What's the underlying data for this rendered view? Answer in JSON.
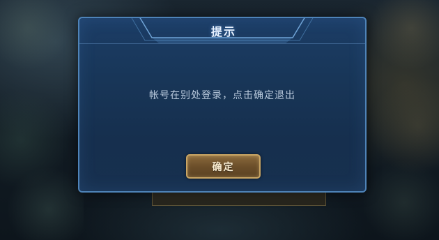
{
  "dialog": {
    "title": "提示",
    "message": "帐号在别处登录，点击确定退出",
    "confirm_label": "确定"
  },
  "colors": {
    "dialog_border": "#4e83b8",
    "dialog_fill": "#183658",
    "button_border": "#c9a564",
    "button_fill": "#6c4f2a"
  }
}
